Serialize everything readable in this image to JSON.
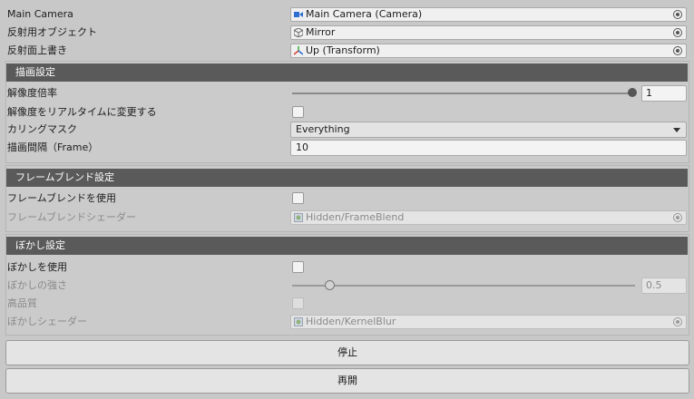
{
  "top": {
    "camera_label": "Main Camera",
    "camera_value": "Main Camera (Camera)",
    "mirror_label": "反射用オブジェクト",
    "mirror_value": "Mirror",
    "up_label": "反射面上書き",
    "up_value": "Up (Transform)"
  },
  "render_settings": {
    "header": "描画設定",
    "resolution_label": "解像度倍率",
    "resolution_value": "1",
    "resolution_fraction": 1.0,
    "realtime_label": "解像度をリアルタイムに変更する",
    "culling_label": "カリングマスク",
    "culling_value": "Everything",
    "interval_label": "描画間隔（Frame）",
    "interval_value": "10"
  },
  "frame_blend": {
    "header": "フレームブレンド設定",
    "use_label": "フレームブレンドを使用",
    "shader_label": "フレームブレンドシェーダー",
    "shader_value": "Hidden/FrameBlend"
  },
  "blur": {
    "header": "ぼかし設定",
    "use_label": "ぼかしを使用",
    "strength_label": "ぼかしの強さ",
    "strength_value": "0.5",
    "strength_fraction": 0.11,
    "quality_label": "高品質",
    "shader_label": "ぼかしシェーダー",
    "shader_value": "Hidden/KernelBlur"
  },
  "buttons": {
    "stop": "停止",
    "restart": "再開"
  },
  "icons": {
    "camera": "camera-icon",
    "gameobject": "cube-icon",
    "transform": "transform-axes-icon",
    "shader": "shader-icon",
    "picker": "object-picker-icon",
    "dropdown": "chevron-down-icon"
  },
  "colors": {
    "background": "#c8c8c8",
    "section_header": "#5a5a5a",
    "camera_icon": "#2f6fd1"
  }
}
